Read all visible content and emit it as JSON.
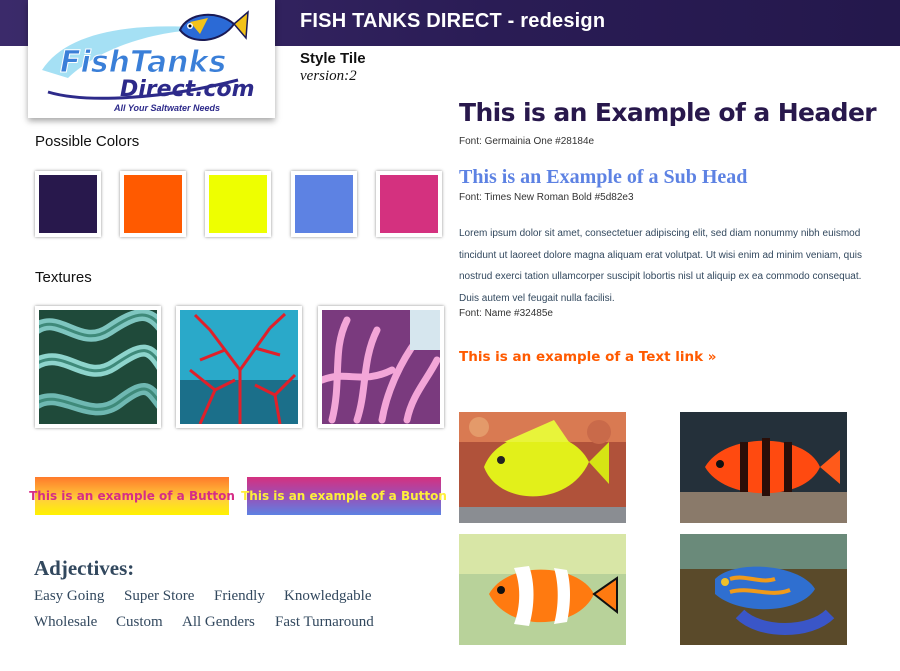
{
  "header": {
    "title": "FISH TANKS DIRECT - redesign"
  },
  "logo": {
    "line1": "FishTanks",
    "line2": "Direct.com",
    "tagline": "All Your Saltwater Needs"
  },
  "tile": {
    "name": "Style Tile",
    "version": "version:2"
  },
  "colors": {
    "label": "Possible Colors",
    "swatches": [
      "#28184c",
      "#ff5a00",
      "#eeff00",
      "#5d82e3",
      "#d4317f"
    ]
  },
  "textures": {
    "label": "Textures"
  },
  "buttons": {
    "primary_label": "This is an example of a Button",
    "secondary_label": "This is an example of a Button"
  },
  "adjectives": {
    "title": "Adjectives:",
    "row1": [
      "Easy Going",
      "Super Store",
      "Friendly",
      "Knowledgable"
    ],
    "row2": [
      "Wholesale",
      "Custom",
      "All Genders",
      "Fast Turnaround"
    ]
  },
  "typography": {
    "header_text": "This is an Example of a Header",
    "header_font": "Font: Germainia One #28184e",
    "subhead_text": "This is an Example of a Sub Head",
    "subhead_font": "Font: Times New Roman Bold #5d82e3",
    "body_text": "Lorem ipsum dolor sit amet, consectetuer adipiscing elit, sed diam nonummy nibh euismod tincidunt ut laoreet dolore magna aliquam erat volutpat. Ut wisi enim ad minim veniam, quis nostrud exerci tation ullamcorper suscipit lobortis nisl ut aliquip ex ea commodo consequat. Duis autem vel feugait nulla facilisi.",
    "body_font": "Font: Name #32485e",
    "link_text": "This is an example of a Text link »"
  }
}
